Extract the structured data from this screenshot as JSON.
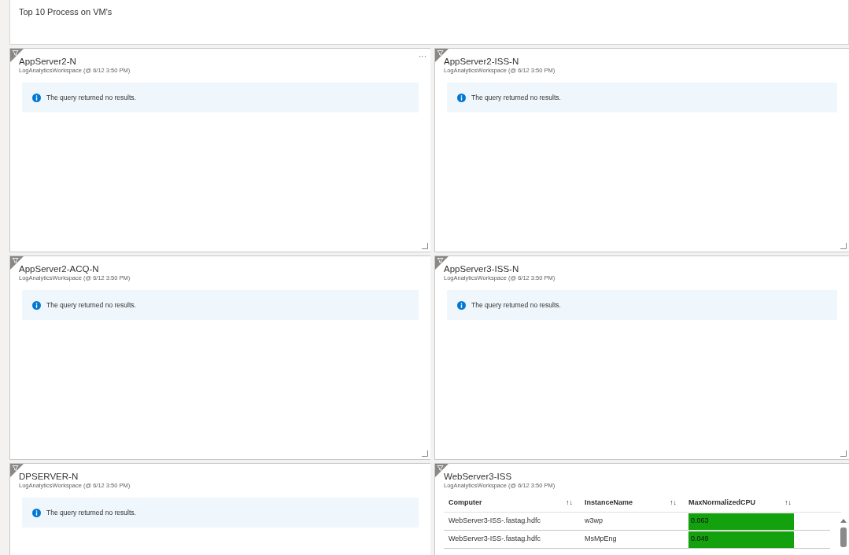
{
  "header": {
    "title": "Top 10 Process on VM's"
  },
  "tiles": [
    {
      "kind": "message",
      "title": "AppServer2-N",
      "subtitle": "LogAnalyticsWorkspace (@ 6/12 3:50 PM)",
      "menu": "···",
      "message": "The query returned no results.",
      "resize_handle": true
    },
    {
      "kind": "message",
      "title": "AppServer2-ISS-N",
      "subtitle": "LogAnalyticsWorkspace (@ 6/12 3:50 PM)",
      "message": "The query returned no results.",
      "resize_handle": true
    },
    {
      "kind": "message",
      "title": "AppServer2-ACQ-N",
      "subtitle": "LogAnalyticsWorkspace (@ 6/12 3:50 PM)",
      "message": "The query returned no results.",
      "resize_handle": true
    },
    {
      "kind": "message",
      "title": "AppServer3-ISS-N",
      "subtitle": "LogAnalyticsWorkspace (@ 6/12 3:50 PM)",
      "message": "The query returned no results.",
      "resize_handle": true
    },
    {
      "kind": "message",
      "title": "DPSERVER-N",
      "subtitle": "LogAnalyticsWorkspace (@ 6/12 3:50 PM)",
      "message": "The query returned no results."
    },
    {
      "kind": "table",
      "title": "WebServer3-ISS",
      "subtitle": "LogAnalyticsWorkspace (@ 6/12 3:50 PM)",
      "columns": [
        {
          "label": "Computer",
          "sort": "↑↓"
        },
        {
          "label": "InstanceName",
          "sort": "↑↓"
        },
        {
          "label": "MaxNormalizedCPU",
          "sort": "↑↓"
        }
      ],
      "rows": [
        [
          "WebServer3-ISS-.fastag.hdfc",
          "w3wp",
          "0.063"
        ],
        [
          "WebServer3-ISS-.fastag.hdfc",
          "MsMpEng",
          "0.049"
        ]
      ]
    }
  ]
}
